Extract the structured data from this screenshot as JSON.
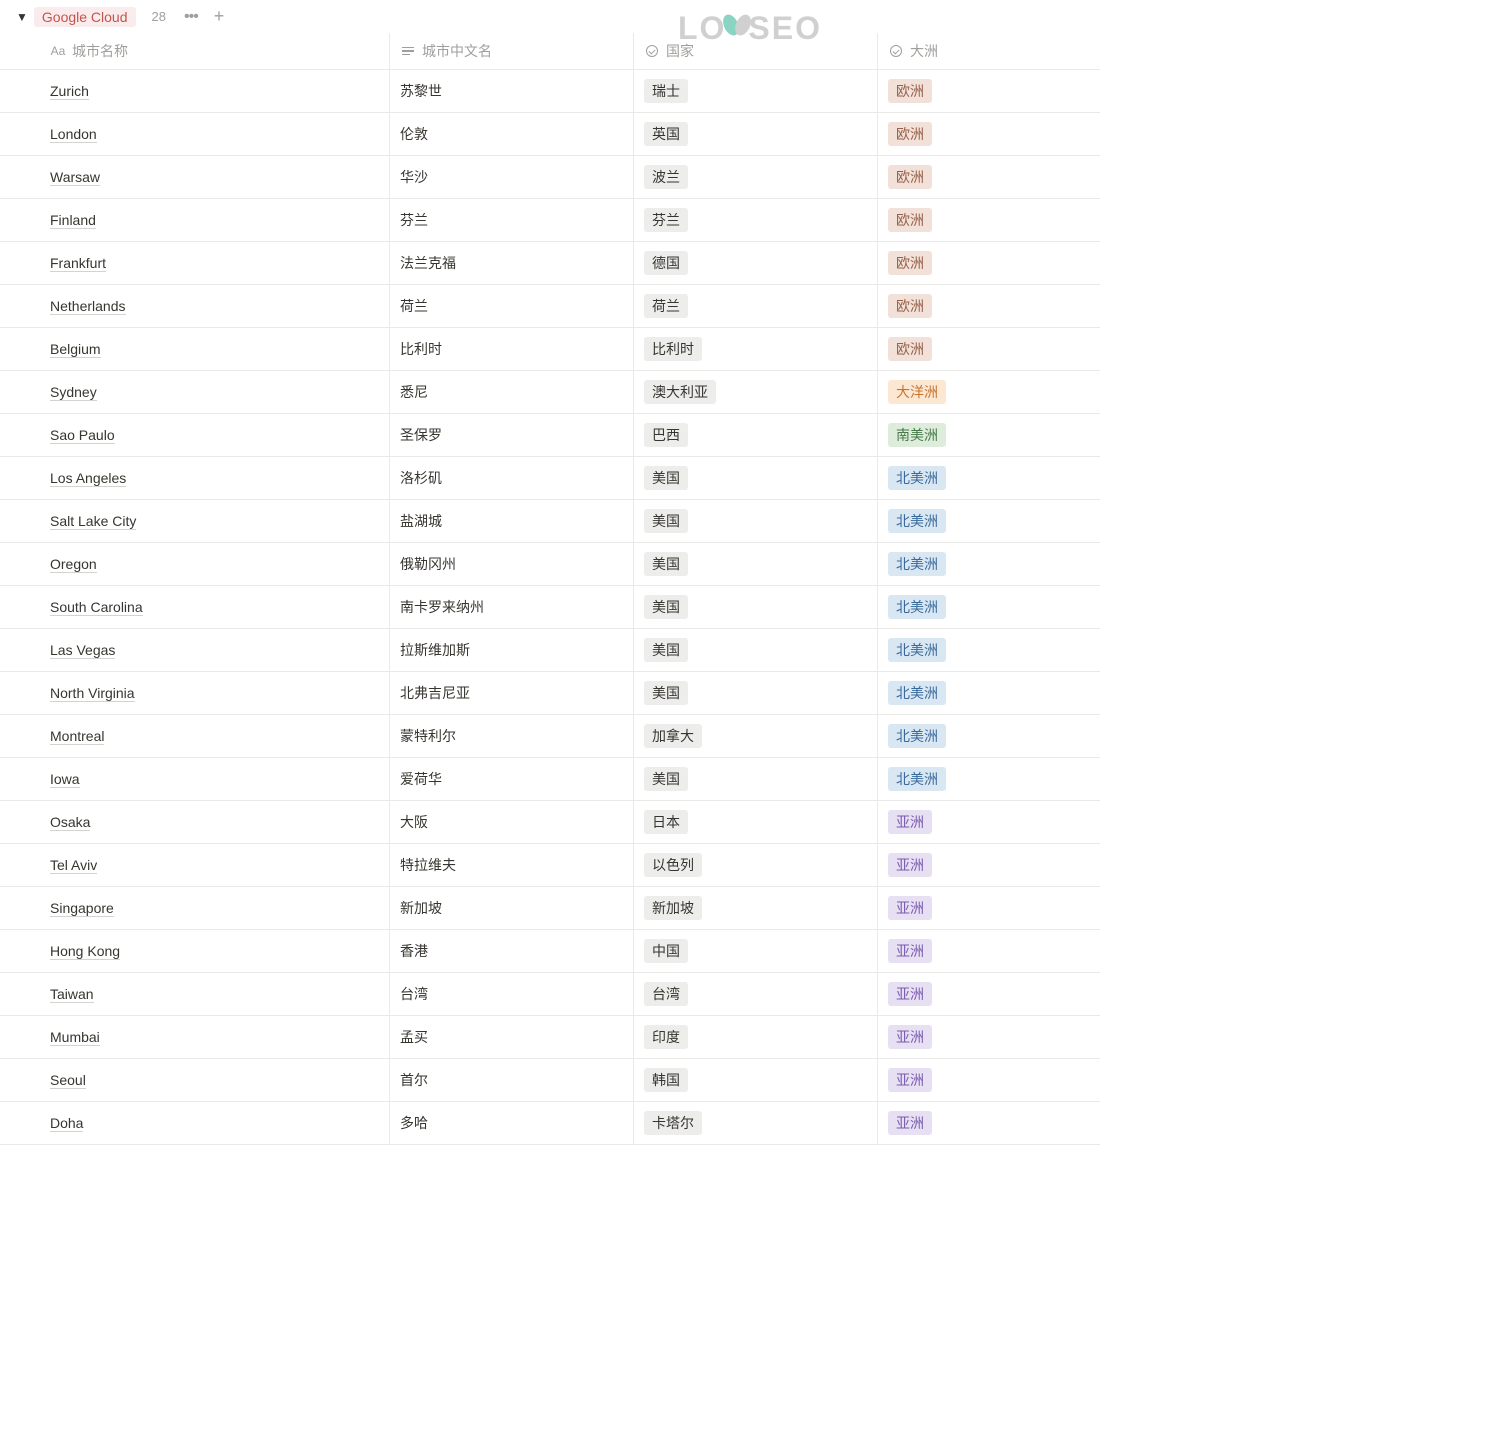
{
  "watermark": "LOYSEO",
  "group": {
    "name": "Google Cloud",
    "count": "28"
  },
  "columns": {
    "name": "城市名称",
    "cn_name": "城市中文名",
    "country": "国家",
    "continent": "大洲"
  },
  "continent_colors": {
    "欧洲": "tag-brown",
    "大洋洲": "tag-orange",
    "南美洲": "tag-green",
    "北美洲": "tag-blue",
    "亚洲": "tag-purple"
  },
  "rows": [
    {
      "name": "Zurich",
      "cn": "苏黎世",
      "country": "瑞士",
      "continent": "欧洲"
    },
    {
      "name": "London",
      "cn": "伦敦",
      "country": "英国",
      "continent": "欧洲"
    },
    {
      "name": "Warsaw",
      "cn": "华沙",
      "country": "波兰",
      "continent": "欧洲"
    },
    {
      "name": "Finland",
      "cn": "芬兰",
      "country": "芬兰",
      "continent": "欧洲"
    },
    {
      "name": "Frankfurt",
      "cn": "法兰克福",
      "country": "德国",
      "continent": "欧洲"
    },
    {
      "name": "Netherlands",
      "cn": "荷兰",
      "country": "荷兰",
      "continent": "欧洲"
    },
    {
      "name": "Belgium",
      "cn": "比利时",
      "country": "比利时",
      "continent": "欧洲"
    },
    {
      "name": "Sydney",
      "cn": "悉尼",
      "country": "澳大利亚",
      "continent": "大洋洲"
    },
    {
      "name": "Sao Paulo",
      "cn": "圣保罗",
      "country": "巴西",
      "continent": "南美洲"
    },
    {
      "name": "Los Angeles",
      "cn": "洛杉矶",
      "country": "美国",
      "continent": "北美洲"
    },
    {
      "name": "Salt Lake City",
      "cn": "盐湖城",
      "country": "美国",
      "continent": "北美洲"
    },
    {
      "name": "Oregon",
      "cn": "俄勒冈州",
      "country": "美国",
      "continent": "北美洲"
    },
    {
      "name": "South Carolina",
      "cn": "南卡罗来纳州",
      "country": "美国",
      "continent": "北美洲"
    },
    {
      "name": "Las Vegas",
      "cn": "拉斯维加斯",
      "country": "美国",
      "continent": "北美洲"
    },
    {
      "name": "North Virginia",
      "cn": "北弗吉尼亚",
      "country": "美国",
      "continent": "北美洲"
    },
    {
      "name": "Montreal",
      "cn": "蒙特利尔",
      "country": "加拿大",
      "continent": "北美洲"
    },
    {
      "name": "Iowa",
      "cn": "爱荷华",
      "country": "美国",
      "continent": "北美洲"
    },
    {
      "name": "Osaka",
      "cn": "大阪",
      "country": "日本",
      "continent": "亚洲"
    },
    {
      "name": "Tel Aviv",
      "cn": "特拉维夫",
      "country": "以色列",
      "continent": "亚洲"
    },
    {
      "name": "Singapore",
      "cn": "新加坡",
      "country": "新加坡",
      "continent": "亚洲"
    },
    {
      "name": "Hong Kong",
      "cn": "香港",
      "country": "中国",
      "continent": "亚洲"
    },
    {
      "name": "Taiwan",
      "cn": "台湾",
      "country": "台湾",
      "continent": "亚洲"
    },
    {
      "name": "Mumbai",
      "cn": "孟买",
      "country": "印度",
      "continent": "亚洲"
    },
    {
      "name": "Seoul",
      "cn": "首尔",
      "country": "韩国",
      "continent": "亚洲"
    },
    {
      "name": "Doha",
      "cn": "多哈",
      "country": "卡塔尔",
      "continent": "亚洲"
    }
  ]
}
